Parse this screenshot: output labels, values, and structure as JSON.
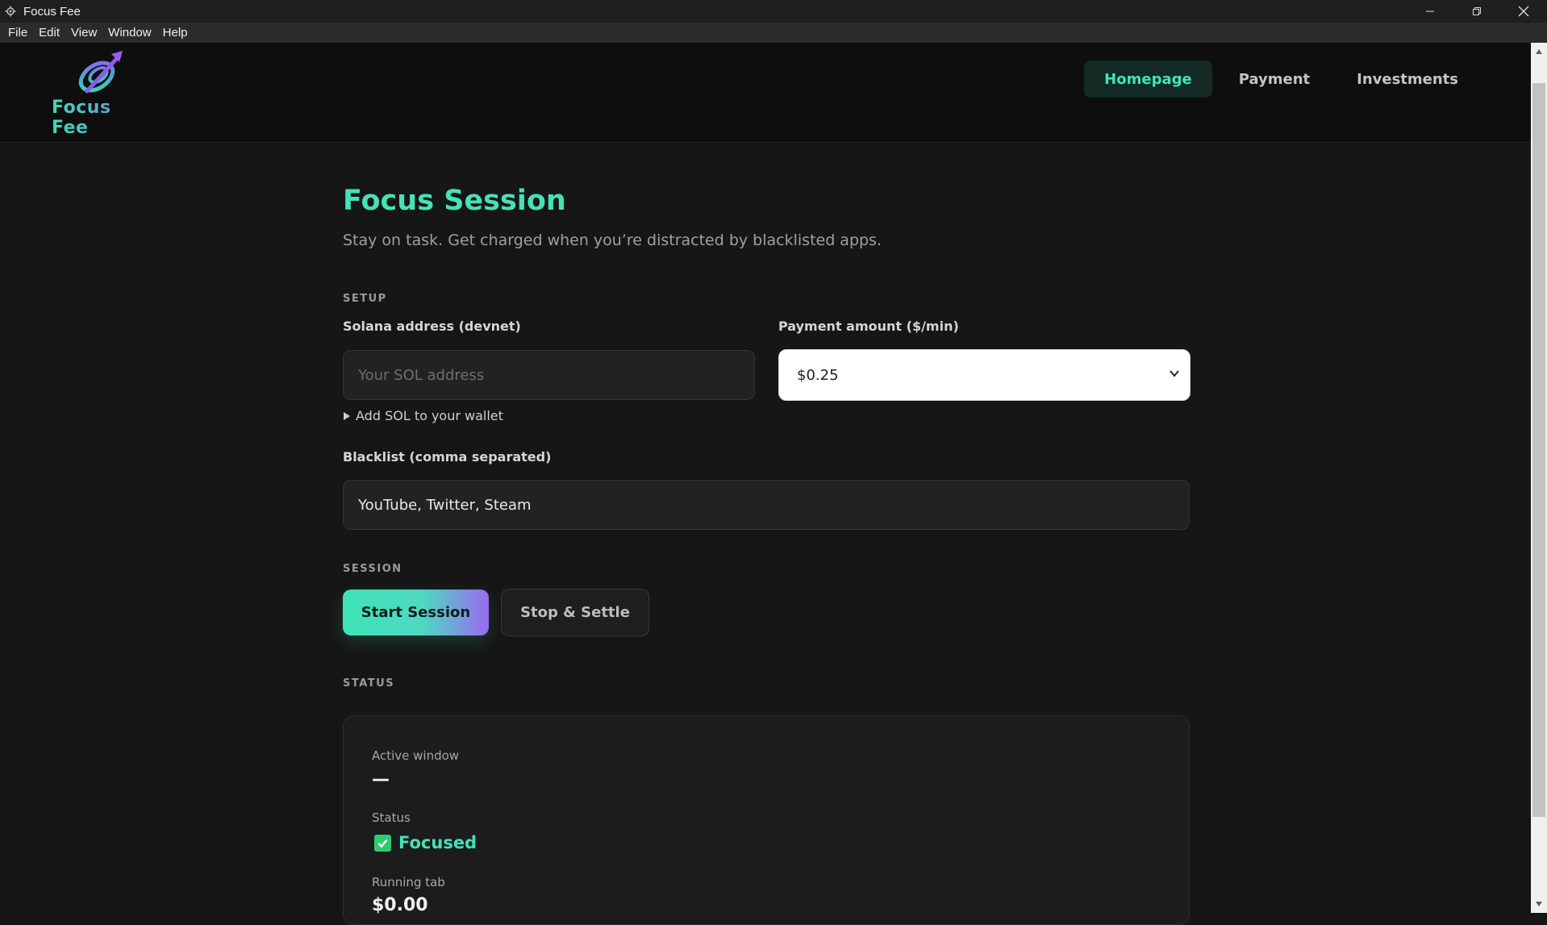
{
  "window": {
    "title": "Focus Fee",
    "menu": [
      "File",
      "Edit",
      "View",
      "Window",
      "Help"
    ]
  },
  "header": {
    "logo_text": "Focus Fee",
    "nav": [
      {
        "label": "Homepage",
        "active": true
      },
      {
        "label": "Payment",
        "active": false
      },
      {
        "label": "Investments",
        "active": false
      }
    ]
  },
  "page": {
    "title": "Focus Session",
    "subtitle": "Stay on task. Get charged when you’re distracted by blacklisted apps."
  },
  "setup": {
    "section_label": "SETUP",
    "sol_label": "Solana address (devnet)",
    "sol_placeholder": "Your SOL address",
    "sol_value": "",
    "payment_label": "Payment amount ($/min)",
    "payment_value": "$0.25",
    "add_sol_toggle": "Add SOL to your wallet",
    "blacklist_label": "Blacklist (comma separated)",
    "blacklist_value": "YouTube, Twitter, Steam"
  },
  "session": {
    "section_label": "SESSION",
    "start_label": "Start Session",
    "stop_label": "Stop & Settle"
  },
  "status": {
    "section_label": "STATUS",
    "active_window_label": "Active window",
    "active_window_value": "—",
    "status_label": "Status",
    "status_value": "Focused",
    "running_tab_label": "Running tab",
    "running_tab_value": "$0.00"
  },
  "colors": {
    "accent": "#44e2b5",
    "accent_purple": "#9a6af0",
    "background": "#161616",
    "header_bg": "#0e0e0e",
    "focused_check": "#2ecc71"
  }
}
